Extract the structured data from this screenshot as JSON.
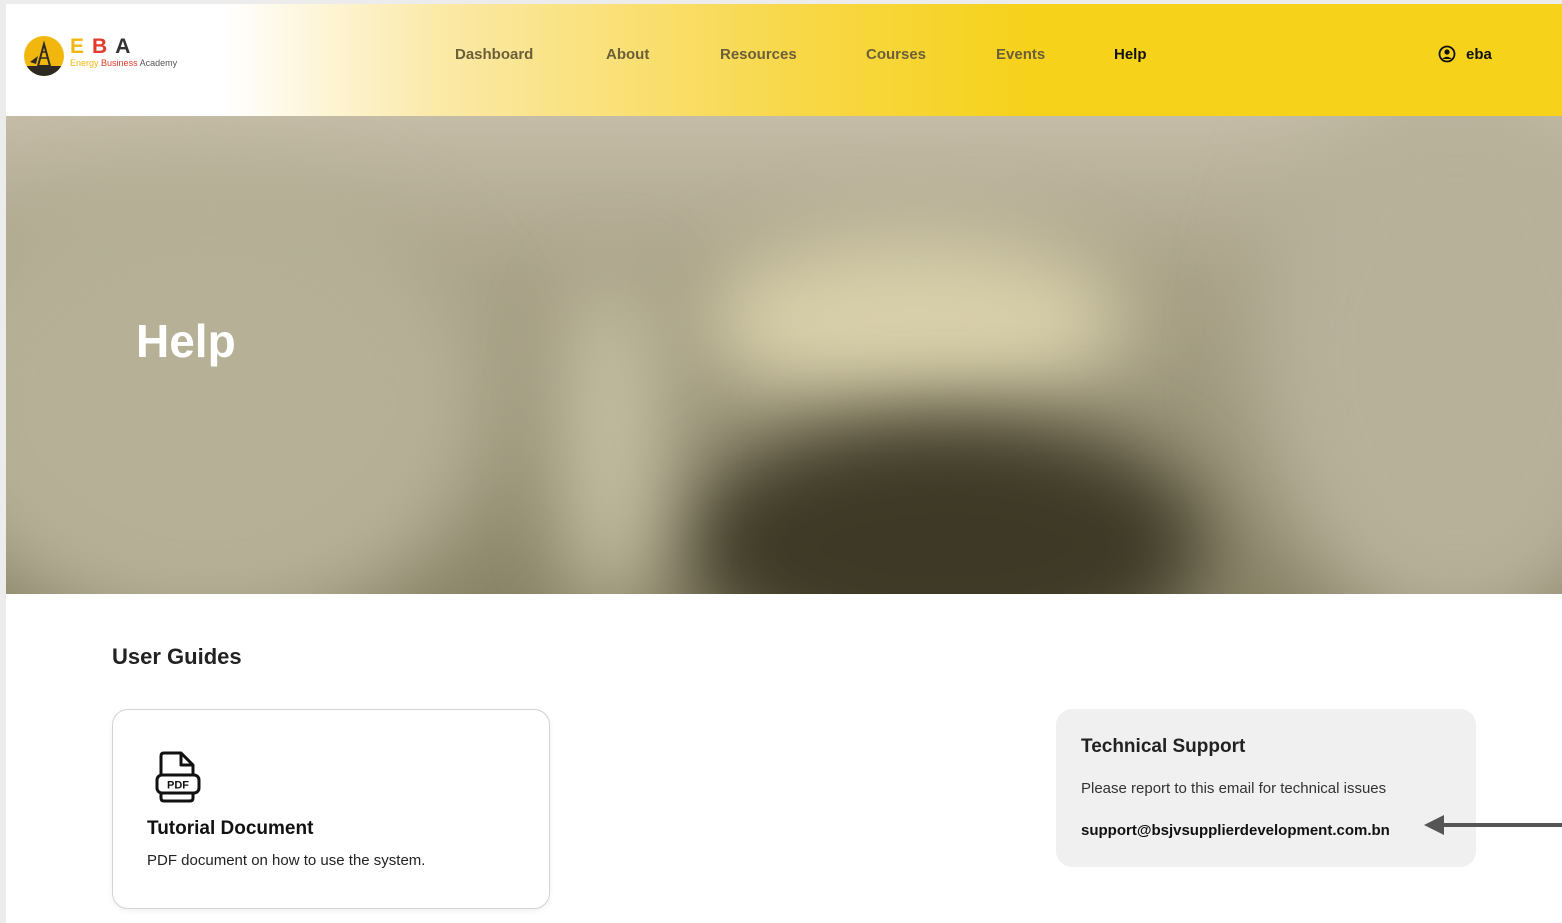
{
  "logo": {
    "letters": [
      "E",
      "B",
      "A"
    ],
    "tagline_parts": [
      "Energy",
      "Business",
      "Academy"
    ]
  },
  "nav": {
    "items": [
      {
        "label": "Dashboard",
        "active": false
      },
      {
        "label": "About",
        "active": false
      },
      {
        "label": "Resources",
        "active": false
      },
      {
        "label": "Courses",
        "active": false
      },
      {
        "label": "Events",
        "active": false
      },
      {
        "label": "Help",
        "active": true
      }
    ]
  },
  "user": {
    "name": "eba",
    "icon": "user-circle-icon"
  },
  "hero": {
    "title": "Help"
  },
  "guides": {
    "section_title": "User Guides",
    "cards": [
      {
        "title": "Tutorial Document",
        "description": "PDF document on how to use the system.",
        "icon": "pdf-file-icon"
      }
    ]
  },
  "support": {
    "title": "Technical Support",
    "description": "Please report to this email for technical issues",
    "email": "support@bsjvsupplierdevelopment.com.bn"
  },
  "colors": {
    "brand_yellow": "#f6d21a",
    "brand_red": "#e23a2b",
    "brand_gold": "#f2b70f",
    "nav_text": "#6b5f3a",
    "annotation_arrow": "#555555"
  }
}
